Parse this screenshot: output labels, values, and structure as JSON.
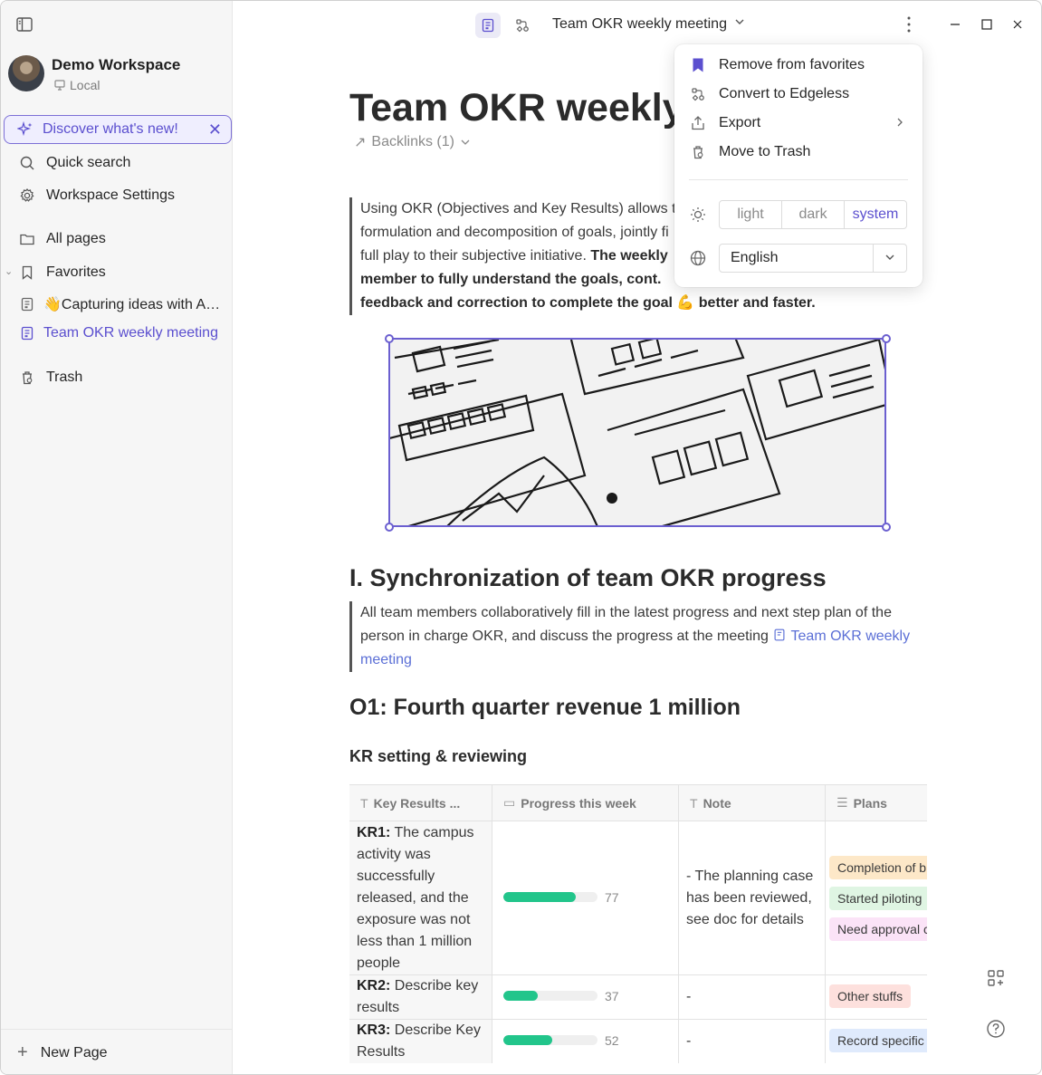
{
  "workspace": {
    "name": "Demo Workspace",
    "storage": "Local"
  },
  "sidebar": {
    "discover": "Discover what's new!",
    "items": [
      {
        "label": "Quick search"
      },
      {
        "label": "Workspace Settings"
      },
      {
        "label": "All pages"
      },
      {
        "label": "Favorites"
      },
      {
        "label": "👋Capturing ideas with AF..."
      },
      {
        "label": "Team OKR weekly meeting"
      },
      {
        "label": "Trash"
      }
    ],
    "new_page": "New Page"
  },
  "header": {
    "title": "Team OKR weekly meeting"
  },
  "doc": {
    "title": "Team OKR weekly",
    "backlinks": "Backlinks (1)",
    "intro_p1": "Using OKR (Objectives and Key Results) allows te",
    "intro_p2": "formulation and decomposition of goals, jointly fi",
    "intro_p3": "full play to their subjective initiative. ",
    "intro_p3_bold": "The weekly",
    "intro_p4_bold": "member to fully understand the goals, cont.",
    "intro_p5_bold": "feedback and correction to complete the goal 💪 better and faster.",
    "section1": "I. Synchronization of team OKR progress",
    "section1_text": "All team members collaboratively fill in the latest progress and next step plan of the person in charge OKR, and discuss the progress at the meeting ",
    "section1_link": "Team OKR weekly meeting",
    "o1": "O1: Fourth quarter revenue 1 million",
    "kr_heading": "KR setting & reviewing"
  },
  "table": {
    "headers": [
      "Key Results ...",
      "Progress this week",
      "Note",
      "Plans"
    ],
    "rows": [
      {
        "kr_label": "KR1:",
        "kr_text": " The campus activity was successfully released, and the exposure was not less than 1 million people",
        "progress": 77,
        "note": "- The planning case has been reviewed, see doc for details",
        "plans": [
          "Completion of b",
          "Started piloting",
          "Need approval c"
        ]
      },
      {
        "kr_label": "KR2:",
        "kr_text": " Describe key results",
        "progress": 37,
        "note": "-",
        "plans": [
          "Other stuffs"
        ]
      },
      {
        "kr_label": "KR3:",
        "kr_text": " Describe Key Results",
        "progress": 52,
        "note": "-",
        "plans": [
          "Record specific r"
        ]
      }
    ],
    "plan_colors": {
      "Completion of b": "#fde8c8",
      "Started piloting": "#dff5e3",
      "Need approval c": "#fbe3f7",
      "Other stuffs": "#fde0dd",
      "Record specific r": "#dfeafc"
    }
  },
  "menu": {
    "items": [
      "Remove from favorites",
      "Convert to Edgeless",
      "Export",
      "Move to Trash"
    ],
    "theme": [
      "light",
      "dark",
      "system"
    ],
    "theme_selected": "system",
    "language": "English"
  },
  "colors": {
    "accent": "#5b4fcf",
    "progress": "#22c58b"
  }
}
